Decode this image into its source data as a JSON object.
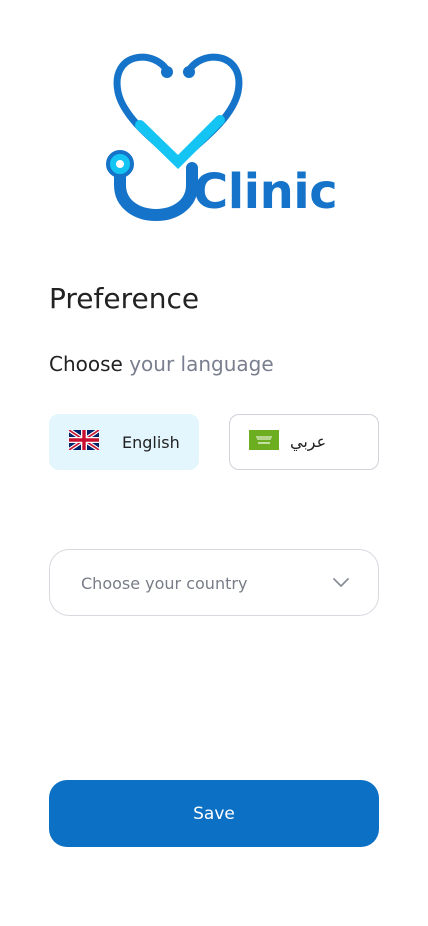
{
  "brand": {
    "name": "Clinic",
    "logo_icon": "stethoscope-heart-icon"
  },
  "page": {
    "title": "Preference"
  },
  "language": {
    "prompt_prefix": "Choose",
    "prompt_suffix": "your language",
    "options": [
      {
        "label": "English",
        "flag": "uk-flag-icon",
        "selected": true
      },
      {
        "label": "عربي",
        "flag": "saudi-flag-icon",
        "selected": false
      }
    ]
  },
  "country": {
    "placeholder": "Choose your country",
    "icon": "chevron-down-icon"
  },
  "actions": {
    "save_label": "Save"
  },
  "colors": {
    "primary": "#0c70c4",
    "logo_blue": "#1574c9",
    "logo_cyan": "#14c4f2",
    "selected_bg": "#e3f5fd",
    "muted_text": "#7a7f8f"
  }
}
